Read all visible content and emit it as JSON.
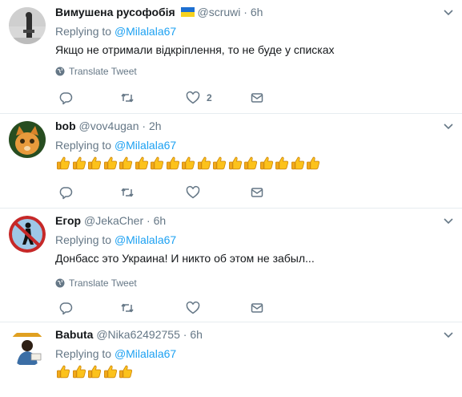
{
  "reply_prefix": "Replying to",
  "tweets": [
    {
      "name": "Вимушена русофобія",
      "handle": "@scruwi",
      "time": "6h",
      "mention": "@Milalala67",
      "text": "Якщо не отримали відкріплення, то не буде у списках",
      "translate": "Translate Tweet",
      "like_count": "2"
    },
    {
      "name": "bob",
      "handle": "@vov4ugan",
      "time": "2h",
      "mention": "@Milalala67",
      "thumbs_count": 17
    },
    {
      "name": "Егор",
      "handle": "@JekaCher",
      "time": "6h",
      "mention": "@Milalala67",
      "text": "Донбасс это Украина! И никто об этом не забыл...",
      "translate": "Translate Tweet"
    },
    {
      "name": "Babuta",
      "handle": "@Nika62492755",
      "time": "6h",
      "mention": "@Milalala67",
      "thumbs_count": 5
    }
  ],
  "colors": {
    "link": "#1da1f2",
    "secondary": "#657786",
    "divider": "#e6ecf0",
    "flag_blue": "#1d6fd1",
    "flag_yellow": "#f7d21e"
  }
}
